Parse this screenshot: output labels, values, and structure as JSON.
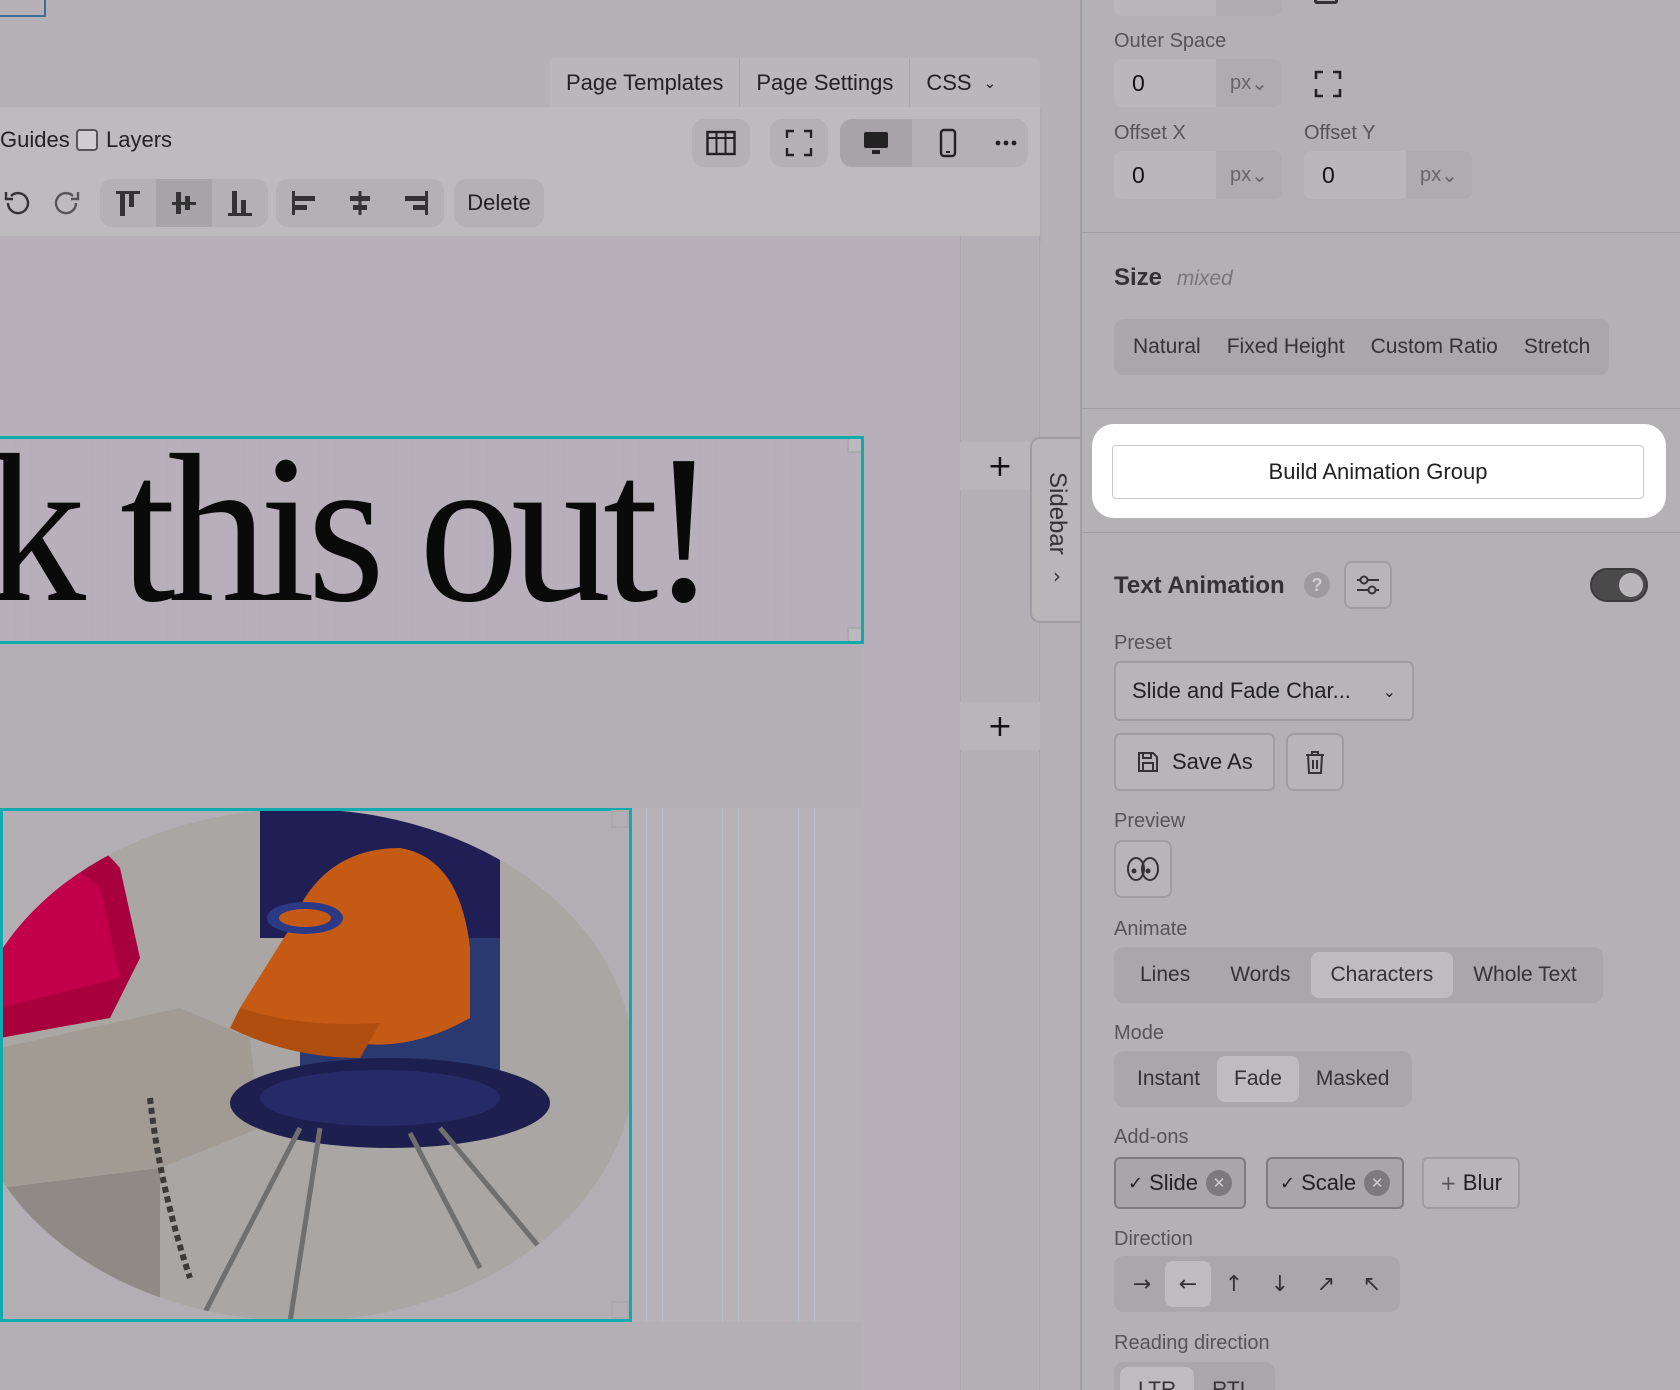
{
  "topbar": {
    "tabs": [
      "Page Templates",
      "Page Settings",
      "CSS"
    ]
  },
  "toolbar": {
    "guides_label": "Guides",
    "layers_label": "Layers",
    "delete_label": "Delete"
  },
  "canvas": {
    "headline": "k this out!",
    "sidebar_tab": "Sidebar"
  },
  "panel": {
    "outer_space": {
      "label": "Outer Space",
      "value": "0",
      "unit": "px"
    },
    "offset_x": {
      "label": "Offset X",
      "value": "0",
      "unit": "px"
    },
    "offset_y": {
      "label": "Offset Y",
      "value": "0",
      "unit": "px"
    },
    "size": {
      "title": "Size",
      "note": "mixed",
      "options": [
        "Natural",
        "Fixed Height",
        "Custom Ratio",
        "Stretch"
      ]
    },
    "build_button": "Build Animation Group",
    "text_animation": {
      "title": "Text Animation",
      "help": "?",
      "enabled": true,
      "preset_label": "Preset",
      "preset_value": "Slide and Fade Char...",
      "save_as": "Save As",
      "preview_label": "Preview",
      "animate_label": "Animate",
      "animate_options": [
        "Lines",
        "Words",
        "Characters",
        "Whole Text"
      ],
      "animate_active": "Characters",
      "mode_label": "Mode",
      "mode_options": [
        "Instant",
        "Fade",
        "Masked"
      ],
      "mode_active": "Fade",
      "addons_label": "Add-ons",
      "addons": [
        "Slide",
        "Scale",
        "Blur"
      ],
      "addons_active": [
        "Slide",
        "Scale"
      ],
      "direction_label": "Direction",
      "directions": [
        "→",
        "←",
        "↑",
        "↓",
        "↗",
        "↖"
      ],
      "direction_active": "←",
      "reading_label": "Reading direction",
      "reading_options": [
        "LTR",
        "RTL"
      ]
    }
  },
  "colors": {
    "selection": "#10a9ae",
    "highlight": "#ffffff"
  }
}
